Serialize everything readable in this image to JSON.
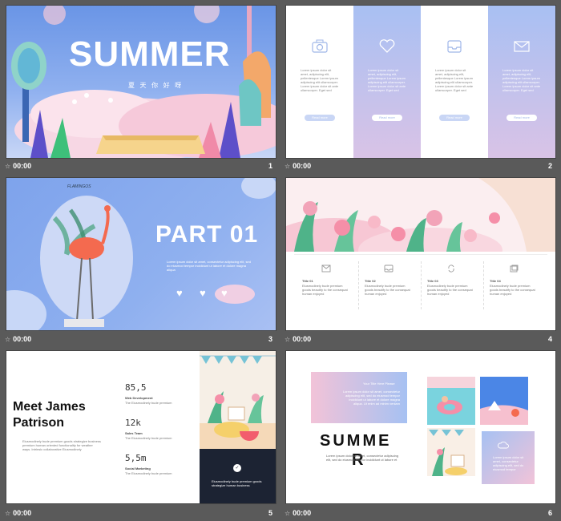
{
  "slides": [
    {
      "num": "1",
      "time": "00:00",
      "title": "SUMMER",
      "subtitle": "夏 天 你 好 呀"
    },
    {
      "num": "2",
      "time": "00:00",
      "columns": [
        {
          "icon": "camera-icon",
          "text": "Lorem ipsum dolor sit amet, adipiscing elit, pellentesque Lorem ipsum adipiscing elit ullamcorper. Lorem ipsum dolor sit ante ullamcorper. Eget sed",
          "button": "Read more"
        },
        {
          "icon": "heart-icon",
          "text": "Lorem ipsum dolor sit amet, adipiscing elit, pellentesque Lorem ipsum adipiscing elit ullamcorper. Lorem ipsum dolor sit ante ullamcorper. Eget sed",
          "button": "Read more"
        },
        {
          "icon": "inbox-icon",
          "text": "Lorem ipsum dolor sit amet, adipiscing elit, pellentesque Lorem ipsum adipiscing elit ullamcorper. Lorem ipsum dolor sit ante ullamcorper. Eget sed",
          "button": "Read more"
        },
        {
          "icon": "mail-icon",
          "text": "Lorem ipsum dolor sit amet, adipiscing elit, pellentesque Lorem ipsum adipiscing elit ullamcorper. Lorem ipsum dolor sit ante ullamcorper. Eget sed",
          "button": "Read more"
        }
      ]
    },
    {
      "num": "3",
      "time": "00:00",
      "tag": "FLAMINGOS",
      "title": "PART 01",
      "text": "Lorem ipsum dolor sit amet, consectetur adipiscing elit, sed do eiusmod tempor incididunt ut labore et dolore magna aliqua"
    },
    {
      "num": "4",
      "time": "00:00",
      "items": [
        {
          "icon": "mail-icon",
          "title": "Title 01",
          "text": "Eiusmodinely bude premium goods beautify to the consequat human enjoyed"
        },
        {
          "icon": "inbox-icon",
          "title": "Title 02",
          "text": "Eiusmodinely bude premium goods beautify to the consequat human enjoyed"
        },
        {
          "icon": "refresh-icon",
          "title": "Title 03",
          "text": "Eiusmodinely bude premium goods beautify to the consequat human enjoyed"
        },
        {
          "icon": "copy-icon",
          "title": "Title 04",
          "text": "Eiusmodinely bude premium goods beautify to the consequat human enjoyed"
        }
      ]
    },
    {
      "num": "5",
      "time": "00:00",
      "name_line1": "Meet James",
      "name_line2": "Patrison",
      "body": "Eiusmodinely bude premium goods strategize business premium human oriented functionality for weather ways. Intrinsic collaborative Eiusmodinely",
      "stats": [
        {
          "value": "85,5",
          "label": "Web Development",
          "text": "The Eiusmodinely bude premium"
        },
        {
          "value": "12k",
          "label": "Sales Team",
          "text": "The Eiusmodinely bude premium"
        },
        {
          "value": "5,5m",
          "label": "Social Marketing",
          "text": "The Eiusmodinely bude premium"
        }
      ],
      "card_text": "Eiusmodinely bude premium goods strategize human business"
    },
    {
      "num": "6",
      "time": "00:00",
      "title_line1": "SUMME",
      "title_line2": "R",
      "box_title": "Your Title Here Please",
      "box_text": "Lorem ipsum dolor sit amet, consectetur adipiscing elit, sed do eiusmod tempor incididunt ut labore et dolore magna aliqua. Ut enim ad minim veniam",
      "caption": "Lorem ipsum dolor sit amet, consectetur adipiscing elit, sed do eiusmod tempor incididunt ut labore et",
      "small_box_text": "Lorem ipsum dolor sit amet, consectetur adipiscing elit, sed do eiusmod tempor"
    }
  ]
}
